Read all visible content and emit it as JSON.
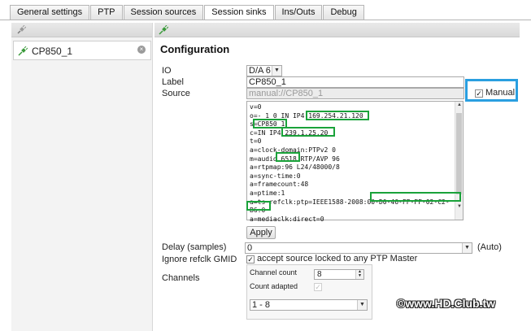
{
  "tabs": [
    "General settings",
    "PTP",
    "Session sources",
    "Session sinks",
    "Ins/Outs",
    "Debug"
  ],
  "active_tab": "Session sinks",
  "sidebar": {
    "items": [
      {
        "label": "CP850_1"
      }
    ]
  },
  "main": {
    "title": "Configuration",
    "labels": {
      "io": "IO",
      "label": "Label",
      "source": "Source",
      "delay": "Delay (samples)",
      "ignore_refclk": "Ignore refclk GMID",
      "channels": "Channels"
    },
    "io_value": "D/A 6",
    "label_value": "CP850_1",
    "source_value": "manual://CP850_1",
    "manual_label": "Manual",
    "manual_checked": true,
    "sdp_lines": [
      "v=0",
      "o=- 1 0 IN IP4 169.254.21.120",
      "s=CP850_1",
      "c=IN IP4 239.1.25.20",
      "t=0",
      "a=clock-domain:PTPv2 0",
      "m=audio 6518 RTP/AVP 96",
      "a=rtpmap:96 L24/48000/8",
      "a=sync-time:0",
      "a=framecount:48",
      "a=ptime:1",
      "a=ts-refclk:ptp=IEEE1588-2008:00-D0-46-FF-FF-02-C2-",
      "B6:0",
      "a=mediaclk:direct=0"
    ],
    "apply_label": "Apply",
    "delay_value": "0",
    "delay_suffix": "(Auto)",
    "ignore_refclk_text": "accept source locked to any PTP Master",
    "channel_count_label": "Channel count",
    "channel_count_value": "8",
    "count_adapted_label": "Count adapted",
    "channel_range": "1 - 8"
  },
  "watermark": "©www.HD.Club.tw",
  "colors": {
    "highlight_green": "#1aa23a",
    "highlight_blue": "#2a9fe0"
  }
}
